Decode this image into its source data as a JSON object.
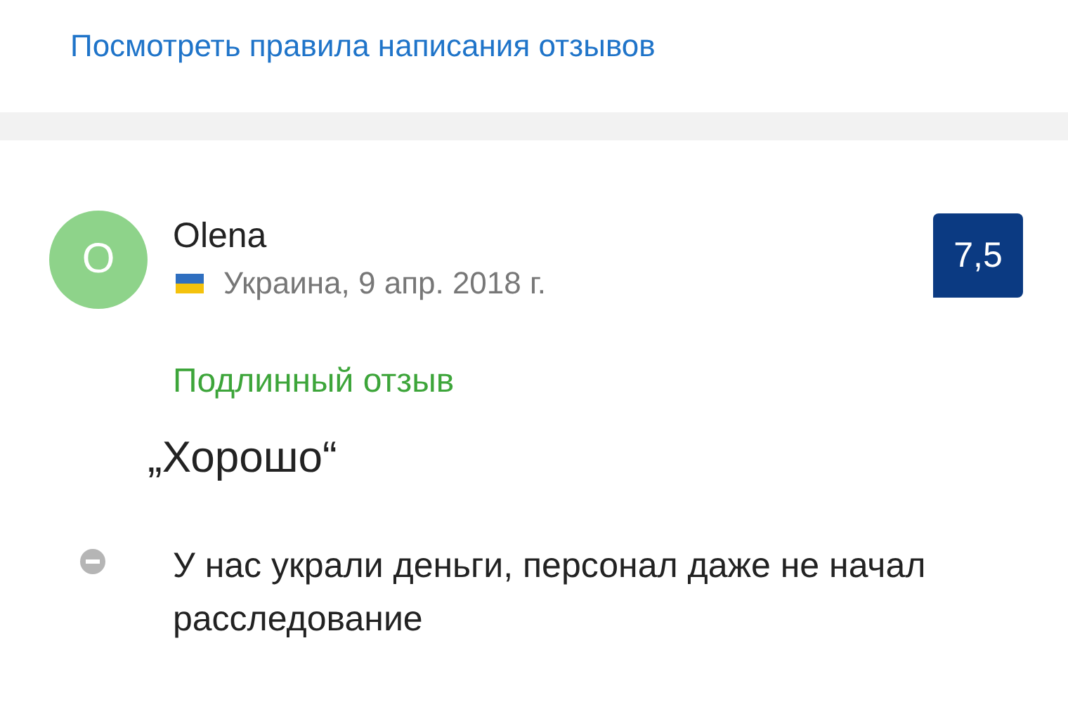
{
  "guidelines_link": "Посмотреть правила написания отзывов",
  "review": {
    "avatar_letter": "O",
    "author": "Olena",
    "country_date": "Украина, 9 апр. 2018 г.",
    "score": "7,5",
    "verified_label": "Подлинный отзыв",
    "title": "„Хорошо“",
    "points": [
      {
        "kind": "negative",
        "text": "У нас украли деньги, персонал даже не начал расследование"
      }
    ]
  }
}
